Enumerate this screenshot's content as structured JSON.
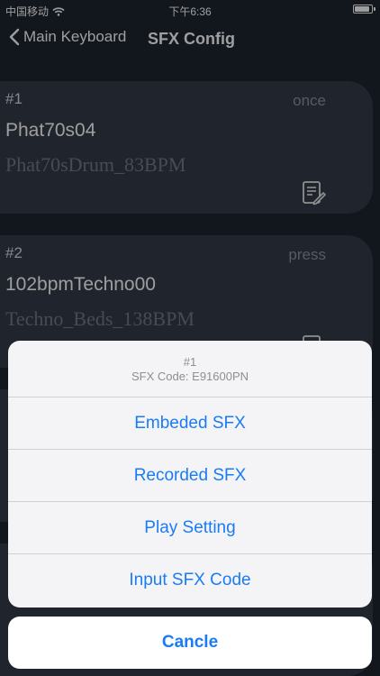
{
  "status": {
    "carrier": "中国移动",
    "time": "下午6:36",
    "battery_level": 0.9
  },
  "nav": {
    "back_label": "Main Keyboard",
    "title": "SFX Config"
  },
  "cards": [
    {
      "index": "#1",
      "mode": "once",
      "name": "Phat70s04",
      "file": "Phat70sDrum_83BPM",
      "icon": "edit-note-icon"
    },
    {
      "index": "#2",
      "mode": "press",
      "name": "102bpmTechno00",
      "file": "Techno_Beds_138BPM",
      "icon": "edit-note-icon"
    }
  ],
  "action_sheet": {
    "title": "#1",
    "subtitle": "SFX Code: E91600PN",
    "actions": [
      "Embeded SFX",
      "Recorded SFX",
      "Play Setting",
      "Input SFX Code"
    ],
    "cancel_label": "Cancle"
  },
  "colors": {
    "background": "#1e2430",
    "card": "#353b47",
    "accent": "#1a7cf5"
  }
}
